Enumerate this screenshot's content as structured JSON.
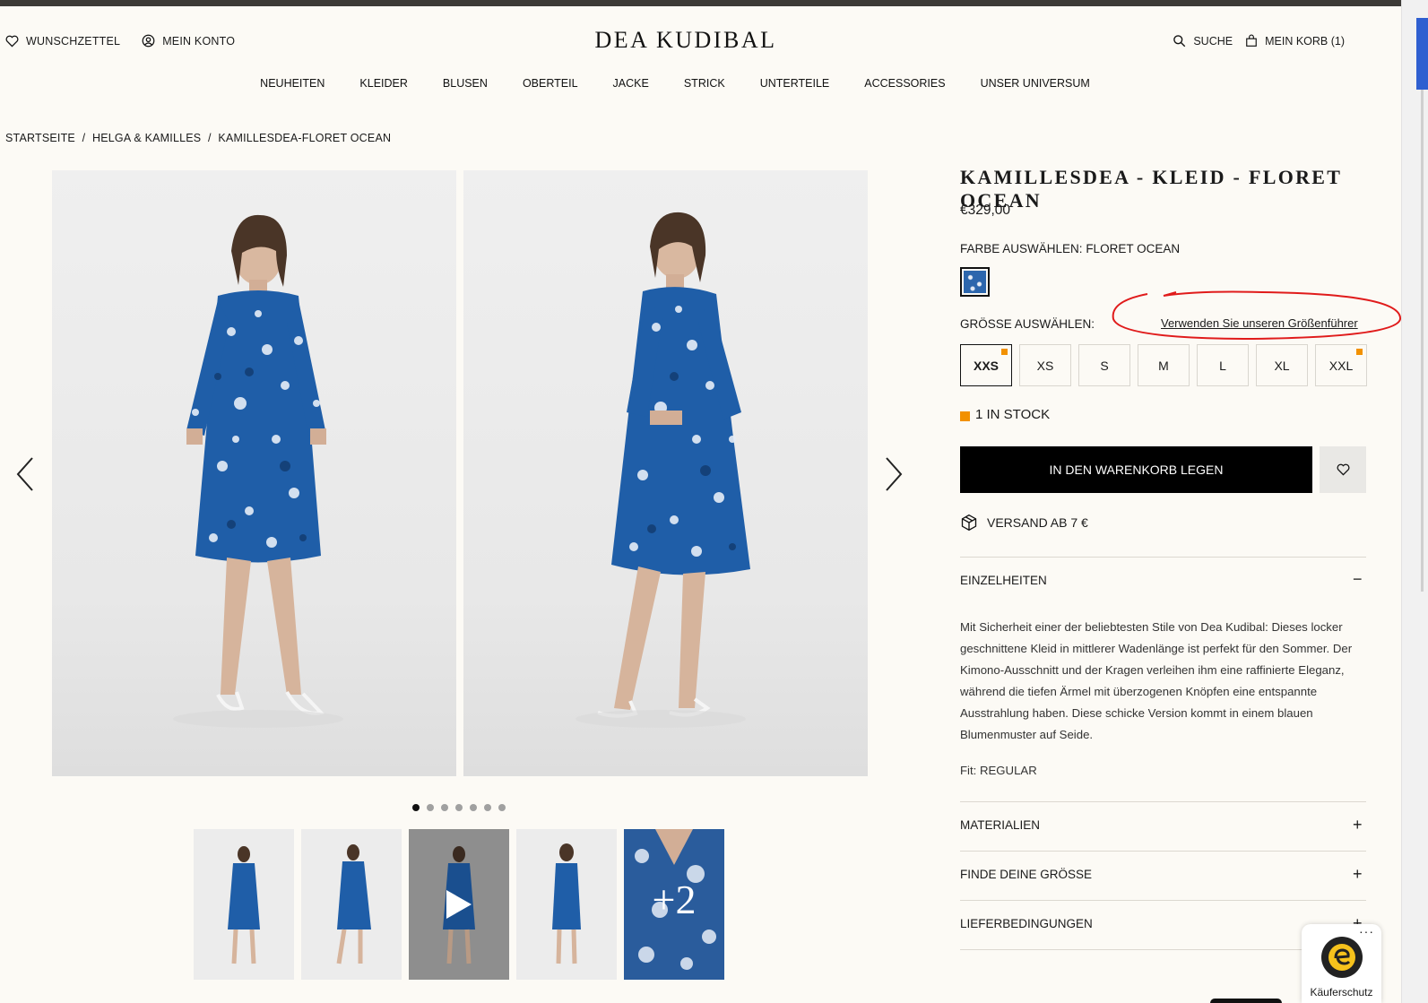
{
  "header": {
    "wishlist": "WUNSCHZETTEL",
    "account": "MEIN KONTO",
    "logo": "DEA KUDIBAL",
    "search": "SUCHE",
    "cart": "MEIN KORB (1)"
  },
  "nav": [
    "NEUHEITEN",
    "KLEIDER",
    "BLUSEN",
    "OBERTEIL",
    "JACKE",
    "STRICK",
    "UNTERTEILE",
    "ACCESSORIES",
    "UNSER UNIVERSUM"
  ],
  "breadcrumb": [
    "STARTSEITE",
    "/",
    "HELGA & KAMILLES",
    "/",
    "KAMILLESDEA-FLORET OCEAN"
  ],
  "gallery": {
    "dot_count": 7,
    "active_dot": 0,
    "more_label": "+2"
  },
  "product": {
    "title": "KAMILLESDEA - KLEID - FLORET OCEAN",
    "price": "€329,00",
    "color_label": "FARBE AUSWÄHLEN:",
    "color_value": "FLORET OCEAN",
    "size_label": "GRÖSSE AUSWÄHLEN:",
    "size_guide": "Verwenden Sie unseren Größenführer",
    "sizes": [
      {
        "label": "XXS",
        "selected": true,
        "low_stock": true
      },
      {
        "label": "XS",
        "selected": false,
        "low_stock": false
      },
      {
        "label": "S",
        "selected": false,
        "low_stock": false
      },
      {
        "label": "M",
        "selected": false,
        "low_stock": false
      },
      {
        "label": "L",
        "selected": false,
        "low_stock": false
      },
      {
        "label": "XL",
        "selected": false,
        "low_stock": false
      },
      {
        "label": "XXL",
        "selected": false,
        "low_stock": true
      }
    ],
    "stock": "1 IN STOCK",
    "add_to_cart": "IN DEN WARENKORB LEGEN",
    "shipping": "VERSAND AB 7 €"
  },
  "accordion": {
    "details_title": "EINZELHEITEN",
    "details_text": "Mit Sicherheit einer der beliebtesten Stile von Dea Kudibal: Dieses locker geschnittene Kleid in mittlerer Wadenlänge ist perfekt für den Sommer. Der Kimono-Ausschnitt und der Kragen verleihen ihm eine raffinierte Eleganz, während die tiefen Ärmel mit überzogenen Knöpfen eine entspannte Ausstrahlung haben. Diese schicke Version kommt in einem blauen Blumenmuster auf Seide.",
    "fit": "Fit: REGULAR",
    "materials": "MATERIALIEN",
    "find_size": "FINDE DEINE GRÖSSE",
    "delivery": "LIEFERBEDINGUNGEN"
  },
  "trust": {
    "label": "Käuferschutz",
    "menu": "···"
  },
  "colors": {
    "accent": "#000000",
    "low_stock": "#f29100",
    "dress_blue": "#1f5ea8",
    "background": "#fcfaf5"
  }
}
